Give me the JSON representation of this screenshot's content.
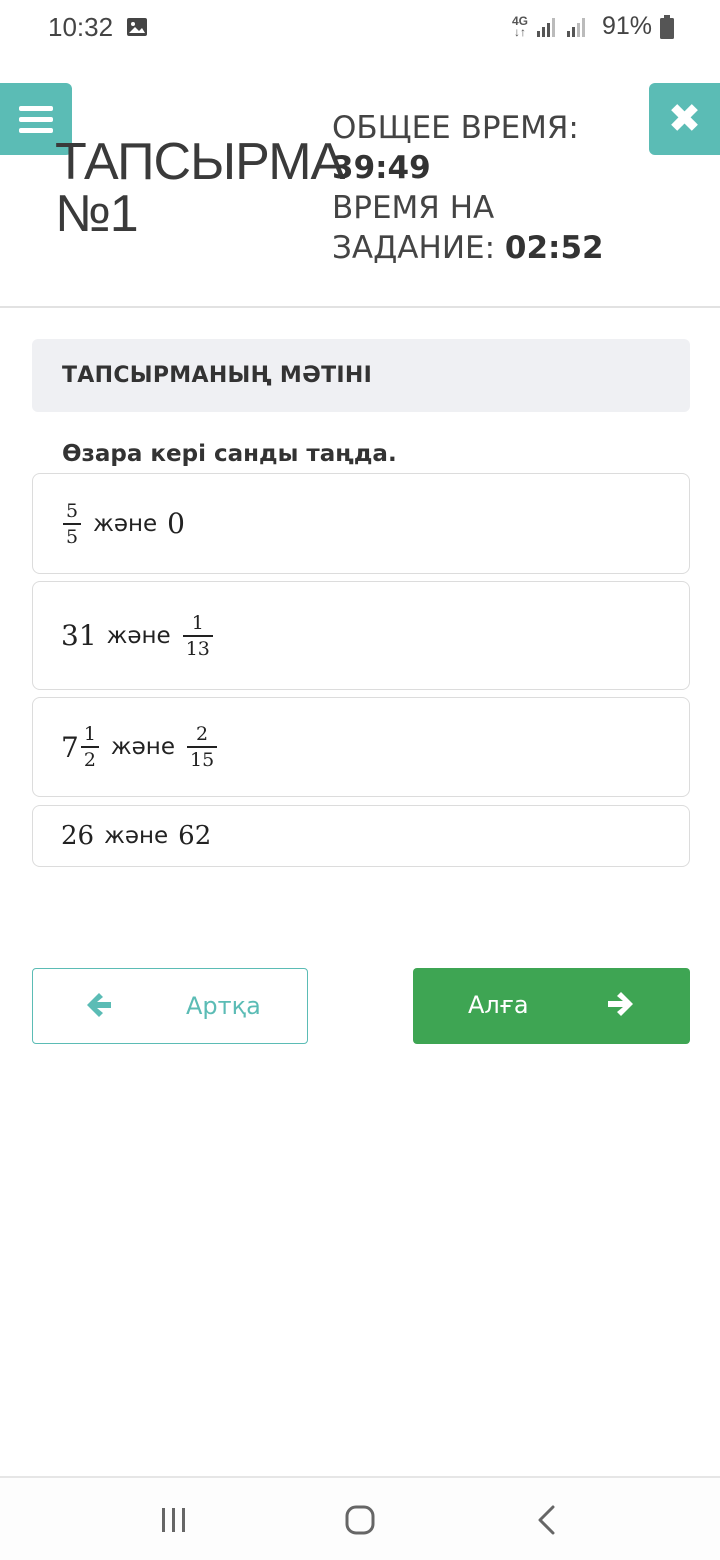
{
  "status_bar": {
    "time": "10:32",
    "network_type": "4G",
    "battery_percent": "91%",
    "icons": [
      "image-icon",
      "signal-icon",
      "signal-icon",
      "battery-icon"
    ]
  },
  "header": {
    "title_line1": "ТАПСЫРМА",
    "title_line2": "№1",
    "total_time_label": "ОБЩЕЕ ВРЕМЯ:",
    "total_time_value": "39:49",
    "task_time_label_line1": "ВРЕМЯ НА",
    "task_time_label_line2": "ЗАДАНИЕ:",
    "task_time_value": "02:52",
    "menu_icon": "hamburger-icon",
    "close_icon": "close-icon"
  },
  "task": {
    "panel_label": "ТАПСЫРМАНЫҢ МӘТІНІ",
    "question": "Өзара кері санды таңда.",
    "connector": "және",
    "options": [
      {
        "left": {
          "num": "5",
          "den": "5"
        },
        "right": "0"
      },
      {
        "left": "31",
        "right": {
          "num": "1",
          "den": "13"
        }
      },
      {
        "left": {
          "whole": "7",
          "num": "1",
          "den": "2"
        },
        "right": {
          "num": "2",
          "den": "15"
        }
      },
      {
        "left": "26",
        "right": "62"
      }
    ]
  },
  "navigation": {
    "back_label": "Артқа",
    "next_label": "Алға"
  },
  "colors": {
    "accent_teal": "#5bbcb5",
    "next_green": "#3ea553",
    "panel_gray": "#eff0f3"
  },
  "system_nav": {
    "icons": [
      "recent-apps-icon",
      "home-icon",
      "back-icon"
    ]
  }
}
